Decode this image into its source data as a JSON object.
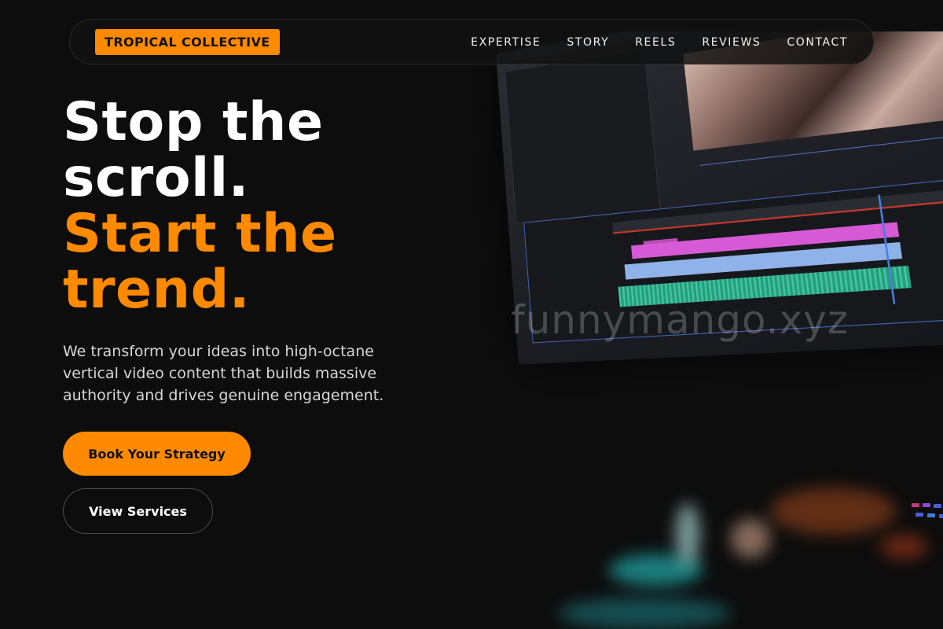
{
  "brand": {
    "name": "TROPICAL COLLECTIVE"
  },
  "nav": {
    "items": [
      {
        "label": "EXPERTISE"
      },
      {
        "label": "STORY"
      },
      {
        "label": "REELS"
      },
      {
        "label": "REVIEWS"
      },
      {
        "label": "CONTACT"
      }
    ]
  },
  "hero": {
    "title_lines": [
      "Stop the",
      "scroll.",
      "Start the",
      "trend."
    ],
    "subtitle": "We transform your ideas into high-octane vertical video content that builds massive authority and drives genuine engagement.",
    "primary_cta": "Book Your Strategy",
    "secondary_cta": "View Services"
  },
  "background": {
    "watermark": "funnymango.xyz",
    "image_description_icon": "video-editor-monitor-image"
  },
  "colors": {
    "accent": "#ff8a00",
    "background": "#0d0d0d",
    "text": "#ffffff",
    "muted_text": "#d6d6d6"
  }
}
